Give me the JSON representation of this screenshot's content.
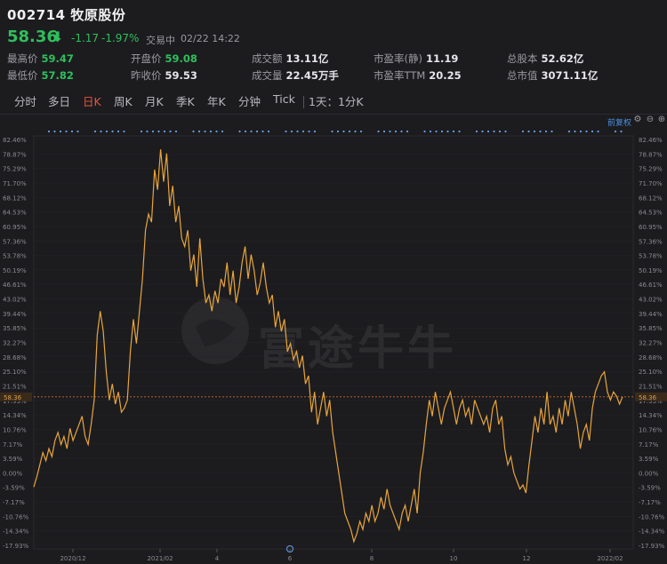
{
  "header": {
    "code": "002714",
    "name": "牧原股份",
    "price": "58.36",
    "change": "-1.17",
    "change_pct": "-1.97%",
    "status": "交易中",
    "time": "02/22 14:22"
  },
  "stats": [
    {
      "label": "最高价",
      "value": "59.47",
      "tone": "down"
    },
    {
      "label": "开盘价",
      "value": "59.08",
      "tone": "down"
    },
    {
      "label": "成交额",
      "value": "13.11亿",
      "tone": "neutral"
    },
    {
      "label": "市盈率(静)",
      "value": "11.19",
      "tone": "neutral"
    },
    {
      "label": "总股本",
      "value": "52.62亿",
      "tone": "neutral"
    },
    {
      "label": "最低价",
      "value": "57.82",
      "tone": "down"
    },
    {
      "label": "昨收价",
      "value": "59.53",
      "tone": "neutral"
    },
    {
      "label": "成交量",
      "value": "22.45万手",
      "tone": "neutral"
    },
    {
      "label": "市盈率TTM",
      "value": "20.25",
      "tone": "neutral"
    },
    {
      "label": "总市值",
      "value": "3071.11亿",
      "tone": "neutral"
    }
  ],
  "tabs": [
    "分时",
    "多日",
    "日K",
    "周K",
    "月K",
    "季K",
    "年K",
    "分钟",
    "Tick"
  ],
  "active_tab": "日K",
  "interval_label": "1天：1分K",
  "adjust_label": "前复权",
  "watermark": "富途牛牛",
  "colors": {
    "bg": "#1c1c1f",
    "line": "#e8a53c",
    "down": "#2fbf5c",
    "up": "#d24d4d",
    "ref": "#c8692a",
    "dots": "#6a9ee8"
  },
  "chart_data": {
    "type": "line",
    "ylabel": "",
    "xlabel": "",
    "y_unit": "%",
    "ylim": [
      -17.93,
      82.46
    ],
    "ytick_labels": [
      "82.46%",
      "78.87%",
      "75.29%",
      "71.70%",
      "68.12%",
      "64.53%",
      "60.95%",
      "57.36%",
      "53.78%",
      "50.19%",
      "46.61%",
      "43.02%",
      "39.44%",
      "35.85%",
      "32.27%",
      "28.68%",
      "25.10%",
      "21.51%",
      "17.93%",
      "14.34%",
      "10.76%",
      "7.17%",
      "3.59%",
      "0.00%",
      "-3.59%",
      "-7.17%",
      "-10.76%",
      "-14.34%",
      "-17.93%"
    ],
    "xtick_labels": [
      "2020/12",
      "2021/02",
      "4",
      "6",
      "8",
      "10",
      "12",
      "2022/02"
    ],
    "current_value_label": "58.36",
    "current_pct": 18.8,
    "series": [
      {
        "values": [
          -3.5,
          -1,
          2,
          5,
          3,
          6,
          4,
          8,
          10,
          7,
          9,
          6,
          11,
          8,
          10,
          12,
          14,
          9,
          7,
          12,
          18,
          34,
          40,
          35,
          25,
          18,
          22,
          17,
          20,
          15,
          16,
          18,
          30,
          38,
          32,
          40,
          48,
          60,
          64,
          62,
          75,
          70,
          80,
          72,
          79,
          66,
          71,
          62,
          66,
          58,
          56,
          60,
          50,
          54,
          46,
          58,
          48,
          42,
          44,
          40,
          45,
          42,
          48,
          46,
          52,
          44,
          50,
          42,
          46,
          52,
          56,
          48,
          54,
          50,
          44,
          47,
          52,
          46,
          42,
          44,
          36,
          40,
          35,
          38,
          30,
          32,
          28,
          30,
          26,
          29,
          22,
          24,
          15,
          20,
          12,
          16,
          20,
          14,
          18,
          10,
          5,
          0,
          -5,
          -10,
          -12,
          -14,
          -17,
          -15,
          -12,
          -14,
          -10,
          -12,
          -8,
          -12,
          -10,
          -6,
          -9,
          -4,
          -8,
          -10,
          -12,
          -14,
          -10,
          -8,
          -12,
          -8,
          -4,
          -10,
          0,
          5,
          12,
          18,
          14,
          20,
          16,
          12,
          16,
          18,
          20,
          16,
          12,
          16,
          18,
          14,
          16,
          12,
          18,
          16,
          14,
          12,
          14,
          10,
          16,
          18,
          12,
          14,
          6,
          2,
          4,
          0,
          -2,
          -4,
          -3,
          -5,
          2,
          8,
          14,
          10,
          16,
          12,
          20,
          12,
          14,
          10,
          16,
          12,
          18,
          14,
          20,
          16,
          12,
          6,
          10,
          12,
          8,
          16,
          20,
          22,
          24,
          25,
          20,
          18,
          20,
          19,
          17,
          18.8
        ]
      }
    ]
  }
}
